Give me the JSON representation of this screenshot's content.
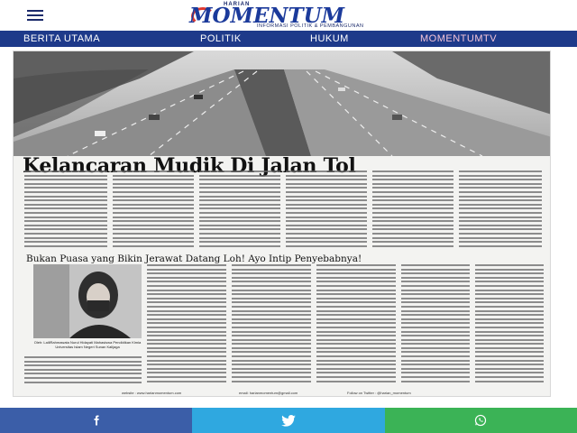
{
  "header": {
    "logo_small": "HARIAN",
    "logo_main": "MOMENTUM",
    "logo_sub": "INFORMASI POLITIK & PEMBANGUNAN",
    "menu_icon": "hamburger-icon"
  },
  "nav": {
    "items": [
      {
        "label": "BERITA UTAMA"
      },
      {
        "label": "POLITIK"
      },
      {
        "label": "HUKUM"
      },
      {
        "label": "MOMENTUMTV"
      }
    ]
  },
  "paper": {
    "headline": "Kelancaran Mudik Di Jalan Tol",
    "subhead": "Bukan Puasa yang Bikin Jerawat Datang Loh! Ayo Intip Penyebabnya!",
    "caption": "Oleh: LailiRahmawata Nurul Hidayati Mahasiswa Pendidikan Kimia Universitas Islam Negeri Sunan Kalijaga",
    "footer_website": "website : www.harianmomentum.com",
    "footer_email": "email: harianmomentum@gmail.com",
    "footer_twitter": "Follow on Twitter : @harian_momentum"
  },
  "share": {
    "facebook_icon": "facebook-icon",
    "twitter_icon": "twitter-icon",
    "whatsapp_icon": "whatsapp-icon"
  },
  "colors": {
    "nav_bg": "#1e3a8a",
    "facebook": "#3b5ea8",
    "twitter": "#2fa8e0",
    "whatsapp": "#3bb356",
    "logo_blue": "#1b3a9b",
    "logo_red": "#e0382f"
  }
}
